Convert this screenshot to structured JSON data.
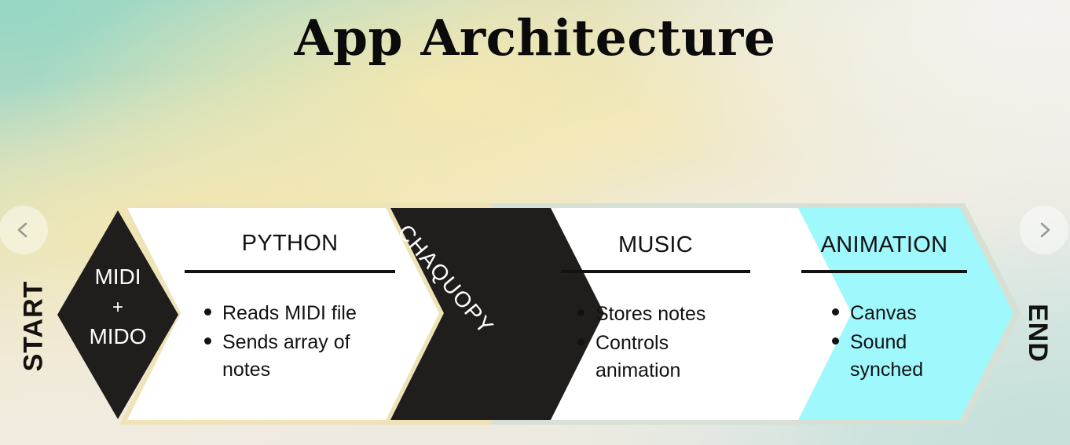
{
  "page": {
    "title": "App Architecture"
  },
  "nav": {
    "prev_icon": "chevron-left-icon",
    "next_icon": "chevron-right-icon",
    "prev_label": "Previous",
    "next_label": "Next"
  },
  "flow": {
    "start_label": "START",
    "end_label": "END",
    "stages": [
      {
        "id": "midi-mido",
        "shape": "diamond",
        "line1": "MIDI",
        "plus": "+",
        "line2": "MIDO",
        "fill": "#201e1c",
        "text_color": "#ffffff"
      },
      {
        "id": "python",
        "shape": "chevron",
        "title": "PYTHON",
        "bullets": [
          "Reads MIDI file",
          "Sends array of notes"
        ],
        "fill": "#ffffff",
        "outline": "#f0e3b8",
        "text_color": "#121212"
      },
      {
        "id": "chaquopy",
        "shape": "chevron",
        "title": "CHAQUOPY",
        "bullets": [],
        "fill": "#201e1c",
        "outline": "#efe2b6",
        "text_color": "#ffffff"
      },
      {
        "id": "music",
        "shape": "chevron",
        "title": "MUSIC",
        "bullets": [
          "Stores notes",
          "Controls animation"
        ],
        "fill": "#ffffff",
        "outline": "#d7e0d5",
        "text_color": "#121212"
      },
      {
        "id": "animation",
        "shape": "chevron",
        "title": "ANIMATION",
        "bullets": [
          "Canvas",
          "Sound synched"
        ],
        "fill": "#9ff8fc",
        "outline": "#d7e0d5",
        "text_color": "#121212"
      }
    ]
  },
  "theme": {
    "background_top_left": "#a3d6c4",
    "background_mid": "#f2e8bc",
    "background_top_right": "#f2f1ef",
    "background_bottom_left": "#f0ebdf",
    "background_bottom_right": "#c9e0dc",
    "dark": "#201e1c",
    "cyan": "#9ff8fc",
    "tan": "#f0e3b8",
    "sage": "#d7e0d5"
  }
}
